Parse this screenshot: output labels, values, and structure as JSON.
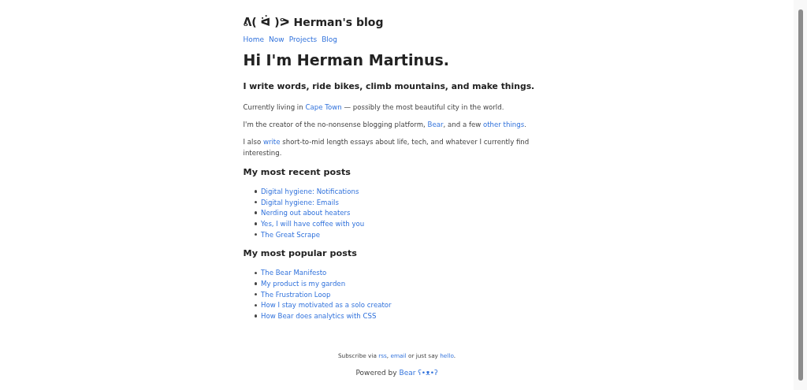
{
  "site_title": "ᕕ( ᐛ )ᕗ Herman's blog",
  "nav": [
    "Home",
    "Now",
    "Projects",
    "Blog"
  ],
  "heading": "Hi I'm Herman Martinus.",
  "tagline": "I write words, ride bikes, climb mountains, and make things.",
  "paragraphs": [
    [
      {
        "text": "Currently living in "
      },
      {
        "text": "Cape Town",
        "link": true
      },
      {
        "text": " — possibly the most beautiful city in the world."
      }
    ],
    [
      {
        "text": "I'm the creator of the no-nonsense blogging platform, "
      },
      {
        "text": "Bear",
        "link": true
      },
      {
        "text": ", and a few "
      },
      {
        "text": "other things",
        "link": true
      },
      {
        "text": "."
      }
    ],
    [
      {
        "text": "I also "
      },
      {
        "text": "write",
        "link": true
      },
      {
        "text": " short-to-mid length essays about life, tech, and whatever I currently find interesting."
      }
    ]
  ],
  "sections": [
    {
      "title": "My most recent posts",
      "posts": [
        "Digital hygiene: Notifications",
        "Digital hygiene: Emails",
        "Nerding out about heaters",
        "Yes, I will have coffee with you",
        "The Great Scrape"
      ]
    },
    {
      "title": "My most popular posts",
      "posts": [
        "The Bear Manifesto",
        "My product is my garden",
        "The Frustration Loop",
        "How I stay motivated as a solo creator",
        "How Bear does analytics with CSS"
      ]
    }
  ],
  "subscribe": [
    {
      "text": "Subscribe via "
    },
    {
      "text": "rss",
      "link": true
    },
    {
      "text": ", "
    },
    {
      "text": "email",
      "link": true
    },
    {
      "text": " or just say "
    },
    {
      "text": "hello",
      "link": true
    },
    {
      "text": "."
    }
  ],
  "powered": [
    {
      "text": "Powered by "
    },
    {
      "text": "Bear ʕ•ᴥ•ʔ",
      "link": true
    }
  ]
}
